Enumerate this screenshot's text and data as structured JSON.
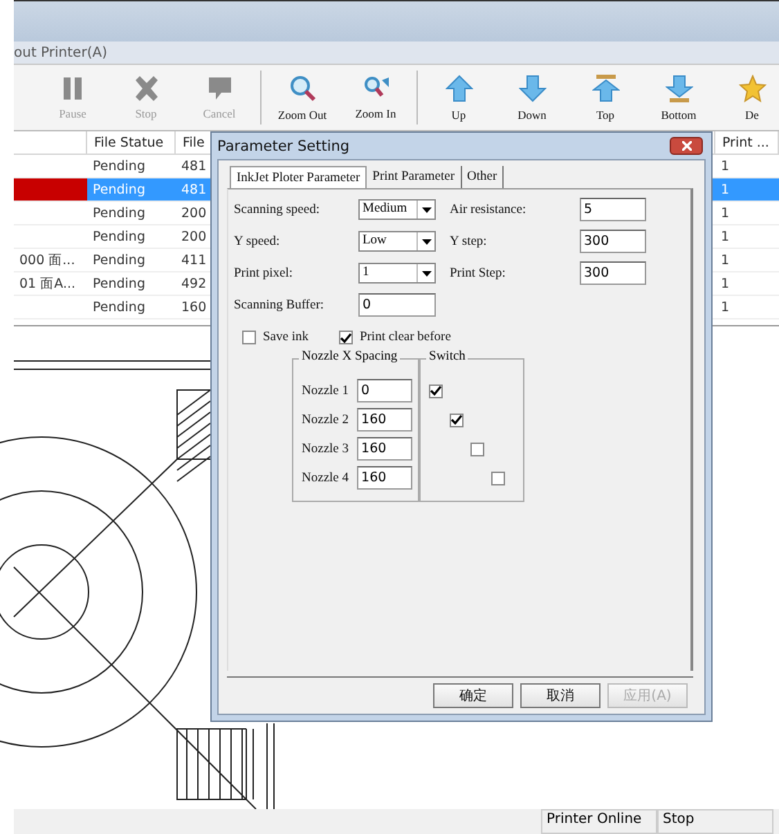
{
  "menu_bar": {
    "text": "out Printer(A)"
  },
  "toolbar": [
    {
      "label": "Pause",
      "disabled": true
    },
    {
      "label": "Stop",
      "disabled": true
    },
    {
      "label": "Cancel",
      "disabled": true
    },
    {
      "label": "Zoom Out",
      "disabled": false
    },
    {
      "label": "Zoom In",
      "disabled": false
    },
    {
      "label": "Up",
      "disabled": false
    },
    {
      "label": "Down",
      "disabled": false
    },
    {
      "label": "Top",
      "disabled": false
    },
    {
      "label": "Bottom",
      "disabled": false
    },
    {
      "label": "De",
      "disabled": false
    }
  ],
  "table": {
    "columns": [
      "File Statue",
      "File",
      "Print ..."
    ],
    "rows": [
      {
        "status": "Pending",
        "file": "481",
        "print": "1",
        "selected": false
      },
      {
        "status": "Pending",
        "file": "481",
        "print": "1",
        "selected": true
      },
      {
        "status": "Pending",
        "file": "200",
        "print": "1",
        "selected": false
      },
      {
        "status": "Pending",
        "file": "200",
        "print": "1",
        "selected": false
      },
      {
        "name": "000 面...",
        "status": "Pending",
        "file": "411",
        "print": "1",
        "selected": false
      },
      {
        "name": "01 面A...",
        "status": "Pending",
        "file": "492",
        "print": "1",
        "selected": false
      },
      {
        "status": "Pending",
        "file": "160",
        "print": "1",
        "selected": false
      }
    ]
  },
  "dialog": {
    "title": "Parameter Setting",
    "tabs": [
      {
        "label": "InkJet Ploter Parameter",
        "selected": true
      },
      {
        "label": "Print Parameter",
        "selected": false
      },
      {
        "label": "Other",
        "selected": false
      }
    ],
    "fields": [
      {
        "label": "Scanning speed:",
        "kind": "select",
        "value": "Medium"
      },
      {
        "label": "Air resistance:",
        "kind": "text",
        "value": "5"
      },
      {
        "label": "Y speed:",
        "kind": "select",
        "value": "Low"
      },
      {
        "label": "Y step:",
        "kind": "text",
        "value": "300"
      },
      {
        "label": "Print pixel:",
        "kind": "select",
        "value": "1"
      },
      {
        "label": "Print Step:",
        "kind": "text",
        "value": "300"
      },
      {
        "label": "Scanning Buffer:",
        "kind": "text",
        "value": "0"
      }
    ],
    "options": [
      {
        "label": "Save ink",
        "checked": false
      },
      {
        "label": "Print clear before",
        "checked": true
      }
    ],
    "nozzles": {
      "title": "Nozzle X Spacing",
      "switch_title": "Switch",
      "items": [
        {
          "label": "Nozzle 1",
          "value": "0",
          "on": true
        },
        {
          "label": "Nozzle 2",
          "value": "160",
          "on": true
        },
        {
          "label": "Nozzle 3",
          "value": "160",
          "on": false
        },
        {
          "label": "Nozzle 4",
          "value": "160",
          "on": false
        }
      ]
    },
    "buttons": [
      {
        "label": "确定",
        "disabled": false
      },
      {
        "label": "取消",
        "disabled": false
      },
      {
        "label": "应用(A)",
        "disabled": true
      }
    ]
  },
  "status_bar": [
    "Printer Online",
    "Stop"
  ]
}
